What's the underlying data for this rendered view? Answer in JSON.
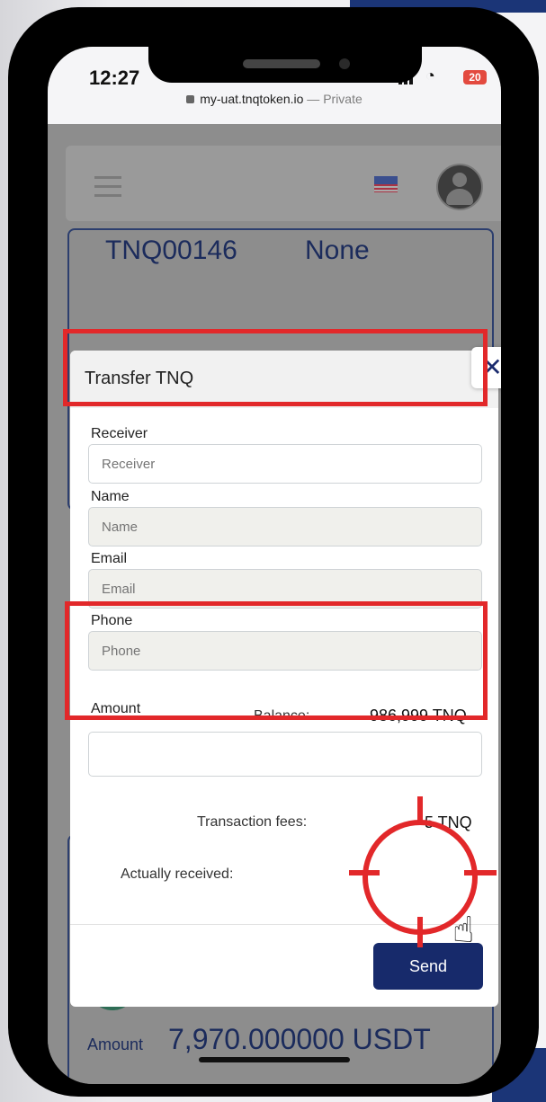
{
  "status": {
    "time": "12:27",
    "battery": "20"
  },
  "browser": {
    "url": "my-uat.tnqtoken.io",
    "sep": " — ",
    "private": "Private"
  },
  "background": {
    "code": "TNQ00146",
    "status": "None",
    "amount_label": "Amount",
    "amount_value": "7,970.000000 USDT"
  },
  "modal": {
    "title": "Transfer TNQ",
    "close_icon": "close-icon",
    "receiver": {
      "label": "Receiver",
      "placeholder": "Receiver"
    },
    "name": {
      "label": "Name",
      "placeholder": "Name"
    },
    "email": {
      "label": "Email",
      "placeholder": "Email"
    },
    "phone": {
      "label": "Phone",
      "placeholder": "Phone"
    },
    "amount": {
      "label": "Amount",
      "value": "",
      "balance_label": "Balance:",
      "balance_value": "986,999 TNQ"
    },
    "fees": {
      "label": "Transaction fees:",
      "value": "5 TNQ"
    },
    "received": {
      "label": "Actually received:"
    },
    "send_label": "Send"
  },
  "colors": {
    "accent": "#172a6b",
    "highlight": "#e2282a",
    "corner": "#1b3577"
  },
  "icons": [
    "hamburger-icon",
    "us-flag-icon",
    "avatar-icon",
    "close-icon",
    "tether-icon",
    "qr-icon",
    "send-icon",
    "chat-icon",
    "hand-pointer-icon",
    "crosshair-icon"
  ]
}
